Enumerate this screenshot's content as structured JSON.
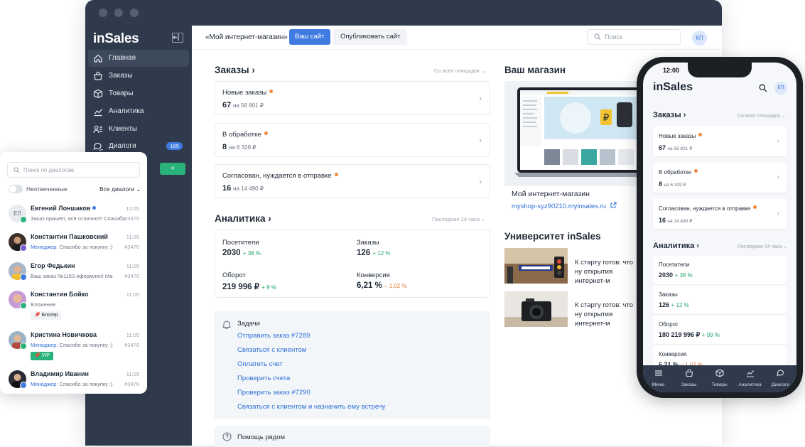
{
  "window": {
    "titlebar_color": "#2f3b4c"
  },
  "sidebar": {
    "logo": "inSales",
    "items": [
      {
        "label": "Главная",
        "icon": "home-icon",
        "active": true
      },
      {
        "label": "Заказы",
        "icon": "basket-icon"
      },
      {
        "label": "Товары",
        "icon": "box-icon"
      },
      {
        "label": "Аналитика",
        "icon": "chart-icon"
      },
      {
        "label": "Клиенты",
        "icon": "clients-icon"
      },
      {
        "label": "Диалоги",
        "icon": "dialogs-icon",
        "badge": "165"
      }
    ],
    "add_button": "+"
  },
  "header": {
    "shop_name": "«Мой интернет-магазин»",
    "your_site": "Ваш сайт",
    "publish": "Опубликовать сайт",
    "search_placeholder": "Поиск",
    "avatar": "КП"
  },
  "orders": {
    "title": "Заказы",
    "filter": "Со всех площадок",
    "cards": [
      {
        "title": "Новые заказы",
        "count": "67",
        "amount": "на 56 801 ₽"
      },
      {
        "title": "В обработке",
        "count": "8",
        "amount": "на 6 329 ₽"
      },
      {
        "title": "Согласован, нуждается в отправке",
        "count": "16",
        "amount": "на 14 490 ₽"
      }
    ]
  },
  "analytics": {
    "title": "Аналитика",
    "filter": "Последние 24 часа",
    "stats": [
      {
        "label": "Посетители",
        "value": "2030",
        "delta": "+ 38 %",
        "dir": "up"
      },
      {
        "label": "Заказы",
        "value": "126",
        "delta": "+ 12 %",
        "dir": "up"
      },
      {
        "label": "Оборот",
        "value": "219 996 ₽",
        "delta": "+ 9 %",
        "dir": "up"
      },
      {
        "label": "Конверсия",
        "value": "6,21 %",
        "delta": "– 1,02 %",
        "dir": "down"
      }
    ]
  },
  "tasks": {
    "title": "Задачи",
    "items": [
      "Отправить заказ #7289",
      "Связаться с клиентом",
      "Оплатить счет",
      "Проверить счета",
      "Проверить заказ #7290",
      "Связаться с клиентом и назначить ему встречу"
    ]
  },
  "help": {
    "title": "Помощь рядом"
  },
  "shop": {
    "title": "Ваш магазин",
    "name": "Мой интернет-магазин",
    "link": "myshop-xyz90210.myinsales.ru"
  },
  "university": {
    "title": "Университет inSales",
    "articles": [
      {
        "text": "К старту готов: что ну открытия интернет-м"
      },
      {
        "text": "К старту готов: что ну открытия интернет-м"
      }
    ]
  },
  "chat": {
    "search_placeholder": "Поиск по диалогам",
    "unanswered": "Неотвеченные",
    "all_dialogs": "Все диалоги",
    "rows": [
      {
        "initials": "ЕЛ",
        "name": "Евгений Лоншаков",
        "time": "12:05",
        "message": "Заказ пришёл, всё отлично!!! Спасибо",
        "num": "#3475",
        "manager": "",
        "tag": "",
        "online": true
      },
      {
        "name": "Константин Пашковский",
        "time": "11:05",
        "manager": "Менеджер:",
        "message": "Спасибо за покупку :)",
        "num": "#3476",
        "tag": ""
      },
      {
        "name": "Егор Федькин",
        "time": "11:05",
        "manager": "",
        "message": "Ваш заказ №1153 оформлен! Ма",
        "num": "#3475",
        "tag": ""
      },
      {
        "name": "Константин Бойко",
        "time": "11:05",
        "manager": "",
        "message": "Вложение",
        "num": "",
        "tag": "Блогер"
      },
      {
        "name": "Кристина Новичкова",
        "time": "11:05",
        "manager": "Менеджер:",
        "message": "Спасибо за покупку :)",
        "num": "#3476",
        "tag": "VIP"
      },
      {
        "name": "Владимир Иванин",
        "time": "11:05",
        "manager": "Менеджер:",
        "message": "Спасибо за покупку :)",
        "num": "#3476",
        "tag": ""
      }
    ]
  },
  "phone": {
    "time": "12:00",
    "logo": "inSales",
    "avatar": "КП",
    "orders_title": "Заказы",
    "orders_filter": "Со всех площадок",
    "cards": [
      {
        "title": "Новые заказы",
        "count": "67",
        "amount": "на 56 801 ₽"
      },
      {
        "title": "В обработке",
        "count": "8",
        "amount": "на 6 329 ₽"
      },
      {
        "title": "Согласован, нуждается в отправке",
        "count": "16",
        "amount": "на 14 490 ₽"
      }
    ],
    "analytics_title": "Аналитика",
    "analytics_filter": "Последние 24 часа",
    "stats": [
      {
        "label": "Посетители",
        "value": "2030",
        "delta": "+ 38 %",
        "dir": "up"
      },
      {
        "label": "Заказы",
        "value": "126",
        "delta": "+ 12 %",
        "dir": "up"
      },
      {
        "label": "Оборот",
        "value": "180 219 996 ₽",
        "delta": "+ 99 %",
        "dir": "up"
      },
      {
        "label": "Конверсия",
        "value": "6,21 %",
        "delta": "– 1,02 %",
        "dir": "down"
      }
    ],
    "tabs": [
      {
        "label": "Меню",
        "icon": "menu-icon"
      },
      {
        "label": "Заказы",
        "icon": "basket-icon"
      },
      {
        "label": "Товары",
        "icon": "box-icon"
      },
      {
        "label": "Аналитика",
        "icon": "chart-icon"
      },
      {
        "label": "Диалоги",
        "icon": "dialogs-icon"
      }
    ]
  },
  "colors": {
    "accent": "#3f7be0",
    "sidebar": "#2f3b4c",
    "green": "#22a667",
    "orange": "#f08a3e",
    "link": "#2e6fd6"
  }
}
